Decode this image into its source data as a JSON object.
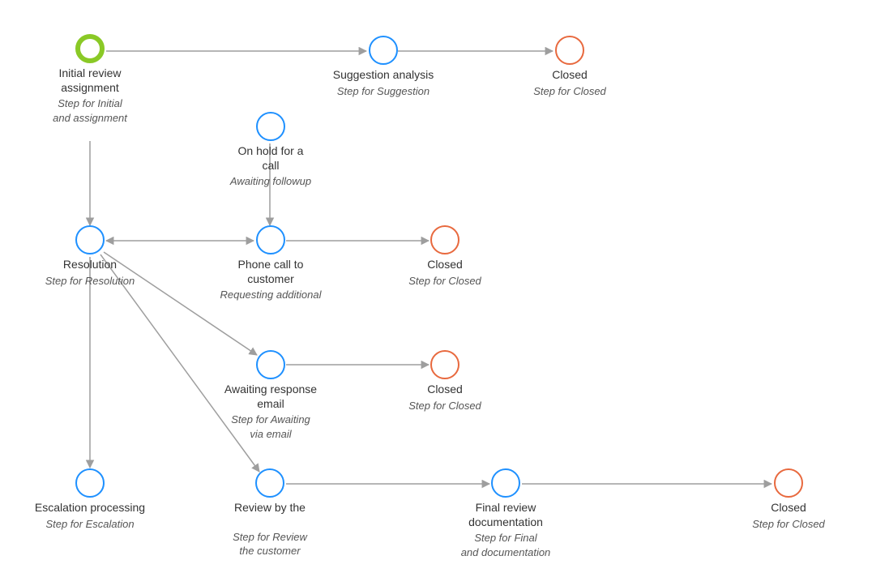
{
  "colors": {
    "start": "#8ac926",
    "state": "#1e90ff",
    "closed": "#e8693e",
    "arrow": "#9e9e9e"
  },
  "nodes": {
    "initial": {
      "label": "Initial review\nassignment",
      "sublabel": "Step for Initial\nand assignment"
    },
    "suggest": {
      "label": "Suggestion analysis",
      "sublabel": "Step for Suggestion"
    },
    "closed1": {
      "label": "Closed",
      "sublabel": "Step for Closed"
    },
    "onhold": {
      "label": "On hold for a\ncall",
      "sublabel": "Awaiting followup"
    },
    "resolution": {
      "label": "Resolution",
      "sublabel": "Step for Resolution"
    },
    "phone": {
      "label": "Phone call to\ncustomer",
      "sublabel": "Requesting additional"
    },
    "closed2": {
      "label": "Closed",
      "sublabel": "Step for Closed"
    },
    "awaiting": {
      "label": "Awaiting response\nemail",
      "sublabel": "Step for Awaiting\nvia email"
    },
    "closed3": {
      "label": "Closed",
      "sublabel": "Step for Closed"
    },
    "escalation": {
      "label": "Escalation processing",
      "sublabel": "Step for Escalation"
    },
    "review": {
      "label": "Review by the",
      "sublabel": "Step for Review\nthe customer"
    },
    "final": {
      "label": "Final review\ndocumentation",
      "sublabel": "Step for Final\nand documentation"
    },
    "closed4": {
      "label": "Closed",
      "sublabel": "Step for Closed"
    }
  }
}
